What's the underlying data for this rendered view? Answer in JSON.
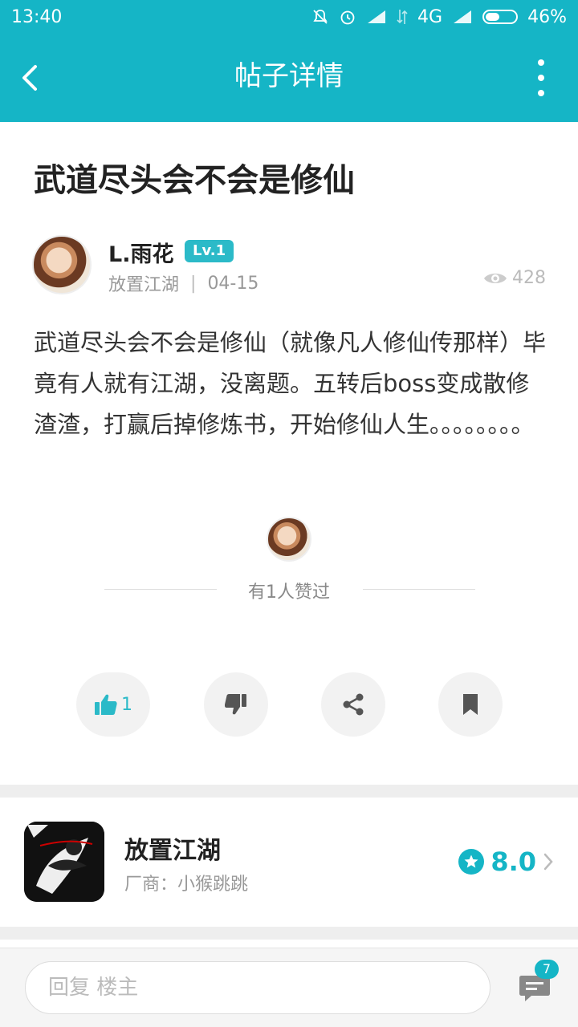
{
  "status_bar": {
    "time": "13:40",
    "network": "4G",
    "battery_percent": "46%",
    "battery_level": 0.46
  },
  "app_bar": {
    "title": "帖子详情"
  },
  "post": {
    "title": "武道尽头会不会是修仙",
    "author": {
      "name": "L.雨花",
      "level": "Lv.1",
      "board": "放置江湖",
      "date": "04-15"
    },
    "views": "428",
    "body": "武道尽头会不会是修仙（就像凡人修仙传那样）毕竟有人就有江湖，没离题。五转后boss变成散修渣渣，打赢后掉修炼书，开始修仙人生。。。。。。。。"
  },
  "likes": {
    "summary": "有1人赞过",
    "count": "1"
  },
  "game": {
    "name": "放置江湖",
    "vendor": "厂商：小猴跳跳",
    "rating": "8.0"
  },
  "reply": {
    "placeholder": "回复  楼主",
    "comment_count": "7"
  },
  "colors": {
    "brand": "#15b5c6",
    "level_badge": "#2bbac8"
  },
  "icons": [
    "back-arrow-icon",
    "more-vert-icon",
    "eye-icon",
    "thumb-up-icon",
    "thumb-down-icon",
    "share-icon",
    "bookmark-icon",
    "star-icon",
    "chevron-right-icon",
    "comment-icon"
  ]
}
